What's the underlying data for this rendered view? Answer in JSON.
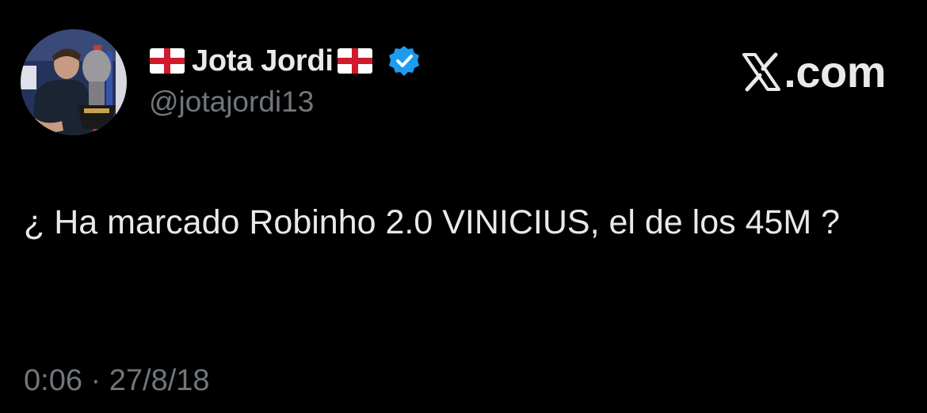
{
  "user": {
    "display_name": "Jota Jordi",
    "handle": "@jotajordi13",
    "verified": true,
    "name_flags": "england-flag"
  },
  "brand": {
    "icon": "x-logo-icon",
    "text": ".com"
  },
  "tweet": {
    "text": "¿ Ha marcado Robinho 2.0 VINICIUS, el de los 45M ?",
    "time": "0:06",
    "separator": "·",
    "date": "27/8/18"
  },
  "colors": {
    "background": "#000000",
    "primary_text": "#e7e9ea",
    "secondary_text": "#71767b",
    "verified_badge": "#1d9bf0"
  }
}
